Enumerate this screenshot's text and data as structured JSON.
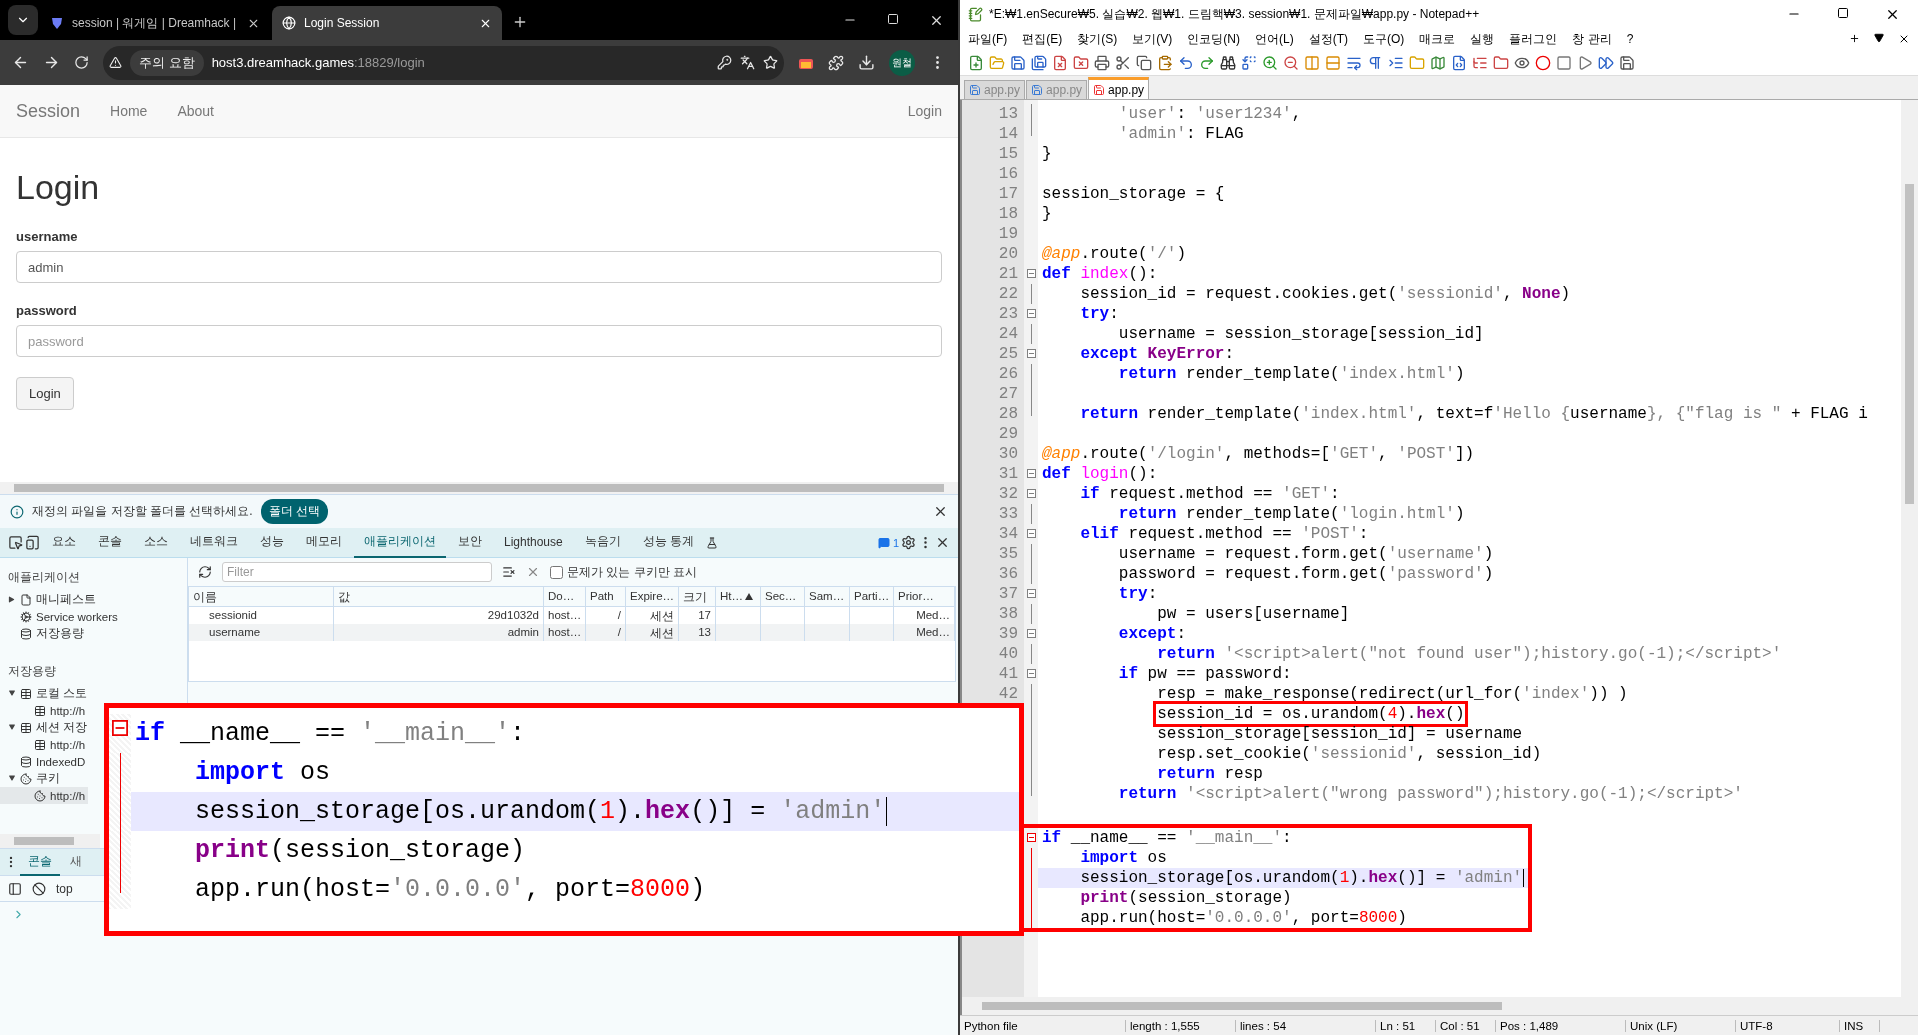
{
  "browser": {
    "tabs": [
      {
        "title": "session | 워게임 | Dreamhack |",
        "selected": false,
        "kind": "shield"
      },
      {
        "title": "Login Session",
        "selected": true,
        "kind": "globe"
      }
    ],
    "security_chip": "주의 요함",
    "url_host": "host3.dreamhack.games",
    "url_path": ":18829/login",
    "profile": "원철",
    "page": {
      "brand": "Session",
      "nav": [
        "Home",
        "About"
      ],
      "nav_right": "Login",
      "heading": "Login",
      "fields": [
        {
          "label": "username",
          "value": "admin"
        },
        {
          "label": "password",
          "placeholder": "password"
        }
      ],
      "submit": "Login"
    },
    "infobar": {
      "message": "재정의 파일을 저장할 폴더를 선택하세요.",
      "button": "폴더 선택"
    }
  },
  "devtools": {
    "tabs": [
      {
        "label": "요소",
        "selected": false,
        "kind": "plain"
      },
      {
        "label": "콘솔",
        "selected": false,
        "kind": "plain"
      },
      {
        "label": "소스",
        "selected": false,
        "kind": "plain"
      },
      {
        "label": "네트워크",
        "selected": false,
        "kind": "plain"
      },
      {
        "label": "성능",
        "selected": false,
        "kind": "plain"
      },
      {
        "label": "메모리",
        "selected": false,
        "kind": "plain"
      },
      {
        "label": "애플리케이션",
        "selected": true,
        "kind": "plain"
      },
      {
        "label": "보안",
        "selected": false,
        "kind": "plain"
      },
      {
        "label": "Lighthouse",
        "selected": false,
        "kind": "plain"
      },
      {
        "label": "녹음기",
        "selected": false,
        "kind": "plain"
      },
      {
        "label": "성능 통계",
        "selected": false,
        "kind": "experimental"
      }
    ],
    "issues_count": "1",
    "sidebar": {
      "app_heading": "애플리케이션",
      "app_items": [
        {
          "label": "매니페스트",
          "kind": "file",
          "expanded": false
        },
        {
          "label": "Service workers",
          "kind": "cog"
        },
        {
          "label": "저장용량",
          "kind": "database"
        }
      ],
      "storage_heading": "저장용량",
      "storage_items": [
        {
          "label": "로컬 스토",
          "kind": "table",
          "expanded": true,
          "selected": false,
          "children": [
            {
              "label": "http://h",
              "kind": "table",
              "selected": false
            }
          ]
        },
        {
          "label": "세션 저장",
          "kind": "table",
          "expanded": true,
          "selected": false,
          "children": [
            {
              "label": "http://h",
              "kind": "table",
              "selected": false
            }
          ]
        },
        {
          "label": "IndexedD",
          "kind": "database",
          "selected": false
        },
        {
          "label": "쿠키",
          "kind": "cookie",
          "expanded": true,
          "selected": false,
          "children": [
            {
              "label": "http://h",
              "kind": "cookie",
              "selected": true
            }
          ]
        }
      ]
    },
    "filter_placeholder": "Filter",
    "only_issues": {
      "label": "문제가 있는 쿠키만 표시",
      "checked": false
    },
    "cookies": {
      "columns": [
        {
          "label": "이름"
        },
        {
          "label": "값"
        },
        {
          "label": "Do…"
        },
        {
          "label": "Path"
        },
        {
          "label": "Expire…"
        },
        {
          "label": "크기"
        },
        {
          "label": "Ht…",
          "sorted": true
        },
        {
          "label": "Sec…"
        },
        {
          "label": "Sam…"
        },
        {
          "label": "Parti…"
        },
        {
          "label": "Prior…"
        }
      ],
      "rows": [
        [
          "sessionid",
          "29d1032d",
          "host…",
          "/",
          "세션",
          "17",
          "",
          "",
          "",
          "",
          "Med…"
        ],
        [
          "username",
          "admin",
          "host…",
          "/",
          "세션",
          "13",
          "",
          "",
          "",
          "",
          "Med…"
        ]
      ]
    },
    "drawer": {
      "tabs": [
        {
          "label": "콘솔",
          "selected": true
        },
        {
          "label": "새",
          "selected": false
        }
      ],
      "context": "top"
    }
  },
  "notepad": {
    "title": "*E:₩1.enSecure₩5. 실습₩2. 웹₩1. 드림핵₩3. session₩1. 문제파일₩app.py - Notepad++",
    "menu": [
      "파일(F)",
      "편집(E)",
      "찾기(S)",
      "보기(V)",
      "인코딩(N)",
      "언어(L)",
      "설정(T)",
      "도구(O)",
      "매크로",
      "실행",
      "플러그인",
      "창 관리",
      "?"
    ],
    "tabs": [
      {
        "label": "app.py",
        "selected": false,
        "modified": false
      },
      {
        "label": "app.py",
        "selected": false,
        "modified": false
      },
      {
        "label": "app.py",
        "selected": true,
        "modified": true
      }
    ],
    "lines": [
      {
        "number": "13",
        "kind": "fold_body",
        "tokens": [
          {
            "kind": "str",
            "text": "        'user'"
          },
          {
            "kind": "plain",
            "text": ": "
          },
          {
            "kind": "str",
            "text": "'user1234'"
          },
          {
            "kind": "plain",
            "text": ","
          }
        ]
      },
      {
        "number": "14",
        "kind": "fold_end",
        "tokens": [
          {
            "kind": "str",
            "text": "        'admin'"
          },
          {
            "kind": "plain",
            "text": ": FLAG"
          }
        ]
      },
      {
        "number": "15",
        "kind": "plain",
        "tokens": [
          {
            "kind": "plain",
            "text": "}"
          }
        ]
      },
      {
        "number": "16",
        "kind": "plain"
      },
      {
        "number": "17",
        "kind": "plain",
        "tokens": [
          {
            "kind": "plain",
            "text": "session_storage = {"
          }
        ]
      },
      {
        "number": "18",
        "kind": "plain",
        "tokens": [
          {
            "kind": "plain",
            "text": "}"
          }
        ]
      },
      {
        "number": "19",
        "kind": "plain"
      },
      {
        "number": "20",
        "kind": "plain",
        "tokens": [
          {
            "kind": "dec",
            "text": "@app"
          },
          {
            "kind": "plain",
            "text": ".route("
          },
          {
            "kind": "str",
            "text": "'/'"
          },
          {
            "kind": "plain",
            "text": ")"
          }
        ]
      },
      {
        "number": "21",
        "kind": "fold_start",
        "tokens": [
          {
            "kind": "kw",
            "text": "def"
          },
          {
            "kind": "fn",
            "text": " index"
          },
          {
            "kind": "plain",
            "text": "():"
          }
        ]
      },
      {
        "number": "22",
        "kind": "fold_body",
        "tokens": [
          {
            "kind": "plain",
            "text": "    session_id = request.cookies.get("
          },
          {
            "kind": "str",
            "text": "'sessionid'"
          },
          {
            "kind": "plain",
            "text": ", "
          },
          {
            "kind": "bi",
            "text": "None"
          },
          {
            "kind": "plain",
            "text": ")"
          }
        ]
      },
      {
        "number": "23",
        "kind": "fold_start",
        "tokens": [
          {
            "kind": "kw",
            "text": "    try"
          },
          {
            "kind": "plain",
            "text": ":"
          }
        ]
      },
      {
        "number": "24",
        "kind": "fold_body",
        "tokens": [
          {
            "kind": "plain",
            "text": "        username = session_storage[session_id]"
          }
        ]
      },
      {
        "number": "25",
        "kind": "fold_start",
        "tokens": [
          {
            "kind": "kw",
            "text": "    except"
          },
          {
            "kind": "bi",
            "text": " KeyError"
          },
          {
            "kind": "plain",
            "text": ":"
          }
        ]
      },
      {
        "number": "26",
        "kind": "fold_body",
        "tokens": [
          {
            "kind": "kw",
            "text": "        return"
          },
          {
            "kind": "plain",
            "text": " render_template("
          },
          {
            "kind": "str",
            "text": "'index.html'"
          },
          {
            "kind": "plain",
            "text": ")"
          }
        ]
      },
      {
        "number": "27",
        "kind": "fold_body"
      },
      {
        "number": "28",
        "kind": "fold_end",
        "tokens": [
          {
            "kind": "kw",
            "text": "    return"
          },
          {
            "kind": "plain",
            "text": " render_template("
          },
          {
            "kind": "str",
            "text": "'index.html'"
          },
          {
            "kind": "plain",
            "text": ", text=f"
          },
          {
            "kind": "str",
            "text": "'Hello {"
          },
          {
            "kind": "plain",
            "text": "username"
          },
          {
            "kind": "str",
            "text": "}, {\"flag is \""
          },
          {
            "kind": "plain",
            "text": " + FLAG i"
          }
        ]
      },
      {
        "number": "29",
        "kind": "plain"
      },
      {
        "number": "30",
        "kind": "plain",
        "tokens": [
          {
            "kind": "dec",
            "text": "@app"
          },
          {
            "kind": "plain",
            "text": ".route("
          },
          {
            "kind": "str",
            "text": "'/login'"
          },
          {
            "kind": "plain",
            "text": ", methods=["
          },
          {
            "kind": "str",
            "text": "'GET'"
          },
          {
            "kind": "plain",
            "text": ", "
          },
          {
            "kind": "str",
            "text": "'POST'"
          },
          {
            "kind": "plain",
            "text": "])"
          }
        ]
      },
      {
        "number": "31",
        "kind": "fold_start",
        "tokens": [
          {
            "kind": "kw",
            "text": "def"
          },
          {
            "kind": "fn",
            "text": " login"
          },
          {
            "kind": "plain",
            "text": "():"
          }
        ]
      },
      {
        "number": "32",
        "kind": "fold_start",
        "tokens": [
          {
            "kind": "kw",
            "text": "    if"
          },
          {
            "kind": "plain",
            "text": " request.method == "
          },
          {
            "kind": "str",
            "text": "'GET'"
          },
          {
            "kind": "plain",
            "text": ":"
          }
        ]
      },
      {
        "number": "33",
        "kind": "fold_body",
        "tokens": [
          {
            "kind": "kw",
            "text": "        return"
          },
          {
            "kind": "plain",
            "text": " render_template("
          },
          {
            "kind": "str",
            "text": "'login.html'"
          },
          {
            "kind": "plain",
            "text": ")"
          }
        ]
      },
      {
        "number": "34",
        "kind": "fold_start",
        "tokens": [
          {
            "kind": "kw",
            "text": "    elif"
          },
          {
            "kind": "plain",
            "text": " request.method == "
          },
          {
            "kind": "str",
            "text": "'POST'"
          },
          {
            "kind": "plain",
            "text": ":"
          }
        ]
      },
      {
        "number": "35",
        "kind": "fold_body",
        "tokens": [
          {
            "kind": "plain",
            "text": "        username = request.form.get("
          },
          {
            "kind": "str",
            "text": "'username'"
          },
          {
            "kind": "plain",
            "text": ")"
          }
        ]
      },
      {
        "number": "36",
        "kind": "fold_body",
        "tokens": [
          {
            "kind": "plain",
            "text": "        password = request.form.get("
          },
          {
            "kind": "str",
            "text": "'password'"
          },
          {
            "kind": "plain",
            "text": ")"
          }
        ]
      },
      {
        "number": "37",
        "kind": "fold_start",
        "tokens": [
          {
            "kind": "kw",
            "text": "        try"
          },
          {
            "kind": "plain",
            "text": ":"
          }
        ]
      },
      {
        "number": "38",
        "kind": "fold_body",
        "tokens": [
          {
            "kind": "plain",
            "text": "            pw = users[username]"
          }
        ]
      },
      {
        "number": "39",
        "kind": "fold_start",
        "tokens": [
          {
            "kind": "kw",
            "text": "        except"
          },
          {
            "kind": "plain",
            "text": ":"
          }
        ]
      },
      {
        "number": "40",
        "kind": "fold_body",
        "tokens": [
          {
            "kind": "kw",
            "text": "            return"
          },
          {
            "kind": "str",
            "text": " '<script>alert(\"not found user\");history.go(-1);</script>'"
          }
        ]
      },
      {
        "number": "41",
        "kind": "fold_start",
        "tokens": [
          {
            "kind": "kw",
            "text": "        if"
          },
          {
            "kind": "plain",
            "text": " pw == password:"
          }
        ]
      },
      {
        "number": "42",
        "kind": "fold_body",
        "tokens": [
          {
            "kind": "plain",
            "text": "            resp = make_response(redirect(url_for("
          },
          {
            "kind": "str",
            "text": "'index'"
          },
          {
            "kind": "plain",
            "text": ")) )"
          }
        ]
      },
      {
        "kind": "fold_body",
        "annotated": true,
        "tokens": [
          {
            "kind": "plain",
            "text": "            session_id = os.urandom("
          },
          {
            "kind": "num",
            "text": "4"
          },
          {
            "kind": "plain",
            "text": ")."
          },
          {
            "kind": "bi",
            "text": "hex"
          },
          {
            "kind": "plain",
            "text": "()"
          }
        ]
      },
      {
        "kind": "fold_body",
        "tokens": [
          {
            "kind": "plain",
            "text": "            session_storage[session_id] = username"
          }
        ]
      },
      {
        "kind": "fold_body",
        "tokens": [
          {
            "kind": "plain",
            "text": "            resp.set_cookie("
          },
          {
            "kind": "str",
            "text": "'sessionid'"
          },
          {
            "kind": "plain",
            "text": ", session_id)"
          }
        ]
      },
      {
        "kind": "fold_body",
        "tokens": [
          {
            "kind": "kw",
            "text": "            return"
          },
          {
            "kind": "plain",
            "text": " resp"
          }
        ]
      },
      {
        "kind": "fold_end",
        "tokens": [
          {
            "kind": "kw",
            "text": "        return"
          },
          {
            "kind": "str",
            "text": " '<script>alert(\"wrong password\");history.go(-1);</script>'"
          }
        ]
      },
      {
        "kind": "plain"
      }
    ],
    "boxed_lines": [
      {
        "kind": "fold_start",
        "current": false,
        "tokens": [
          {
            "kind": "kw",
            "text": "if"
          },
          {
            "kind": "plain",
            "text": " __name__ == "
          },
          {
            "kind": "str",
            "text": "'__main__'"
          },
          {
            "kind": "plain",
            "text": ":"
          }
        ]
      },
      {
        "kind": "fold_body",
        "current": false,
        "tokens": [
          {
            "kind": "kw",
            "text": "    import"
          },
          {
            "kind": "plain",
            "text": " os"
          }
        ]
      },
      {
        "kind": "fold_body",
        "current": true,
        "tokens": [
          {
            "kind": "plain",
            "text": "    session_storage[os.urandom("
          },
          {
            "kind": "num",
            "text": "1"
          },
          {
            "kind": "plain",
            "text": ")."
          },
          {
            "kind": "bi",
            "text": "hex"
          },
          {
            "kind": "plain",
            "text": "()] = "
          },
          {
            "kind": "str",
            "text": "'admin'"
          }
        ]
      },
      {
        "kind": "fold_body",
        "current": false,
        "tokens": [
          {
            "kind": "bi",
            "text": "    print"
          },
          {
            "kind": "plain",
            "text": "(session_storage)"
          }
        ]
      },
      {
        "kind": "fold_body",
        "current": false,
        "tokens": [
          {
            "kind": "plain",
            "text": "    app.run(host="
          },
          {
            "kind": "str",
            "text": "'0.0.0.0'"
          },
          {
            "kind": "plain",
            "text": ", port="
          },
          {
            "kind": "num",
            "text": "8000"
          },
          {
            "kind": "plain",
            "text": ")"
          }
        ]
      }
    ],
    "status": [
      "Python file",
      "length : 1,555",
      "lines : 54",
      "Ln : 51",
      "Col : 51",
      "Pos : 1,489",
      "Unix (LF)",
      "UTF-8",
      "INS"
    ]
  },
  "callout": {
    "lines": [
      {
        "kind": "fold_start",
        "current": false,
        "tokens": [
          {
            "kind": "kw",
            "text": "if"
          },
          {
            "kind": "plain",
            "text": " __name__ == "
          },
          {
            "kind": "str",
            "text": "'__main__'"
          },
          {
            "kind": "plain",
            "text": ":"
          }
        ]
      },
      {
        "kind": "fold_body",
        "current": false,
        "tokens": [
          {
            "kind": "kw",
            "text": "    import"
          },
          {
            "kind": "plain",
            "text": " os"
          }
        ]
      },
      {
        "kind": "fold_body",
        "current": true,
        "tokens": [
          {
            "kind": "plain",
            "text": "    session_storage[os.urandom("
          },
          {
            "kind": "num",
            "text": "1"
          },
          {
            "kind": "plain",
            "text": ")."
          },
          {
            "kind": "bi",
            "text": "hex"
          },
          {
            "kind": "plain",
            "text": "()] = "
          },
          {
            "kind": "str",
            "text": "'admin'"
          }
        ]
      },
      {
        "kind": "fold_body",
        "current": false,
        "tokens": [
          {
            "kind": "bi",
            "text": "    print"
          },
          {
            "kind": "plain",
            "text": "(session_storage)"
          }
        ]
      },
      {
        "kind": "fold_end",
        "current": false,
        "tokens": [
          {
            "kind": "plain",
            "text": "    app.run(host="
          },
          {
            "kind": "str",
            "text": "'0.0.0.0'"
          },
          {
            "kind": "plain",
            "text": ", port="
          },
          {
            "kind": "num",
            "text": "8000"
          },
          {
            "kind": "plain",
            "text": ")"
          }
        ]
      }
    ]
  }
}
